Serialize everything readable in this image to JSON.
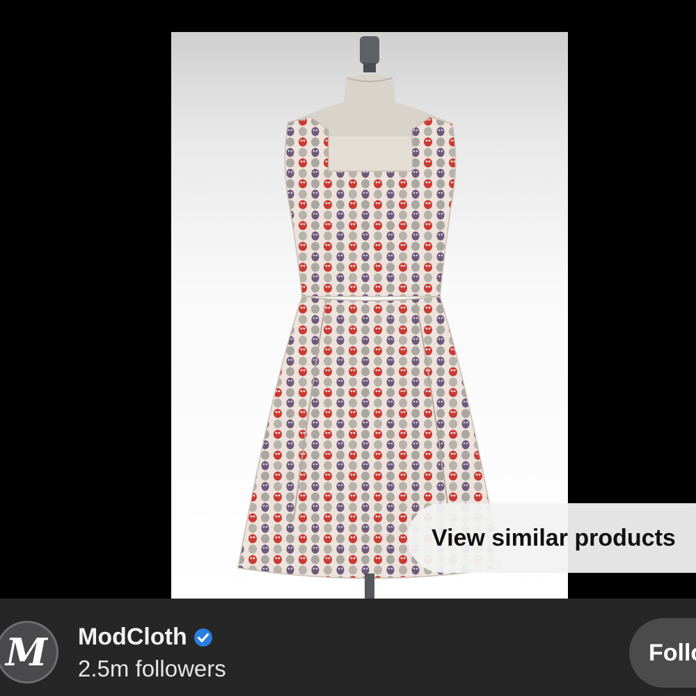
{
  "pin": {
    "image_subject": "sleeveless-patterned-dress-on-dress-form",
    "similar_button_label": "View similar products"
  },
  "creator": {
    "avatar_letter": "M",
    "name": "ModCloth",
    "followers": "2.5m followers",
    "follow_label": "Follow",
    "verified_color": "#2a7de1"
  },
  "colors": {
    "background": "#000000",
    "footer": "#262626",
    "pill": "#f2f2f2",
    "follow_button": "#4b4b4b"
  }
}
